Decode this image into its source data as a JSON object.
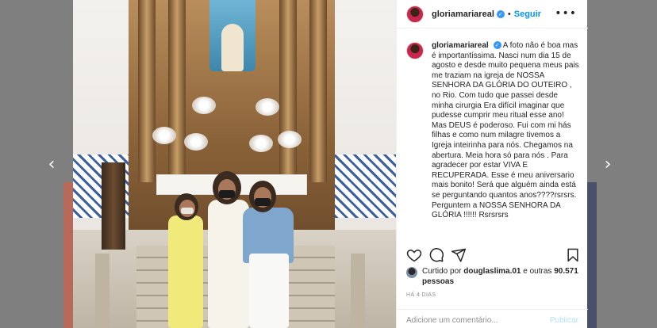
{
  "navigation": {
    "prev_arrow": "‹",
    "next_arrow": "›"
  },
  "post": {
    "username": "gloriamariareal",
    "verified_mark": "✓",
    "separator": "•",
    "follow_label": "Seguir",
    "more_label": "•••",
    "caption": "A foto não é boa mas é importantíssima. Nasci num dia 15 de agosto e desde muito pequena meus pais me traziam na igreja de NOSSA SENHORA DA GLÓRIA DO OUTEIRO , no Rio. Com tudo que passei desde minha cirurgia Era difícil imaginar que pudesse cumprir meu ritual esse ano! Mas DEUS é poderoso. Fui com mi hás filhas e como num milagre tivemos a Igreja inteirinha para nós. Chegamos na abertura. Meia hora só para nós . Para agradecer por estar VIVA E RECUPERADA. Esse é meu aniversario mais bonito! Será que alguém ainda está se perguntando quantos anos????rsrsrs. Perguntem a NOSSA SENHORA DA GLÓRIA !!!!!! Rsrsrsrs",
    "likes_prefix": "Curtido por ",
    "liked_by_user": "douglaslima.01",
    "likes_mid": " e outras ",
    "likes_count": "90.571 pessoas",
    "timestamp": "HÁ 4 DIAS",
    "comment_placeholder": "Adicione um comentário...",
    "publish_label": "Publicar"
  },
  "icons": {
    "like": "heart-icon",
    "comment": "comment-icon",
    "share": "share-icon",
    "save": "bookmark-icon"
  },
  "colors": {
    "accent": "#0095f6",
    "verified": "#3897f0",
    "text": "#262626",
    "muted": "#8e8e8e",
    "publish_disabled": "#b2dffc"
  }
}
